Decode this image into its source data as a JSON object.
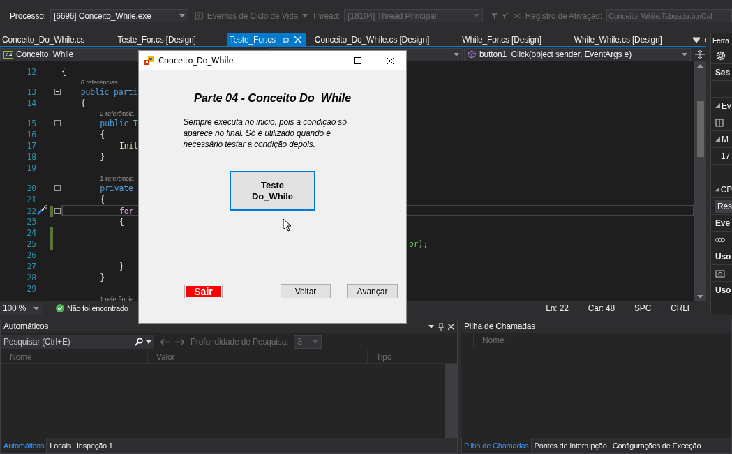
{
  "toolbar": {
    "process_label": "Processo:",
    "process": "[6696] Conceito_While.exe",
    "lifecycle": "Eventos de Ciclo de Vida",
    "thread_label": "Thread:",
    "thread": "[18104] Thread Principal",
    "frame_label": "Registro de Ativação:",
    "frame": "Conceito_While.Tabuada.btnCal"
  },
  "tabs": [
    {
      "label": "Conceito_Do_While.cs",
      "selected": false
    },
    {
      "label": "Teste_For.cs [Design]",
      "selected": false
    },
    {
      "label": "Teste_For.cs",
      "selected": true
    },
    {
      "label": "Conceito_Do_While.cs [Design]",
      "selected": false
    },
    {
      "label": "While_For.cs [Design]",
      "selected": false
    },
    {
      "label": "While_While.cs [Design]",
      "selected": false
    }
  ],
  "nav_bar": {
    "project": "Conceito_While",
    "member": "button1_Click(object sender, EventArgs e)"
  },
  "code_lines": [
    {
      "number": "12",
      "segments": [
        {
          "text": "{",
          "kind": "plain"
        }
      ],
      "collapsible": false,
      "changed": false,
      "current": false,
      "children": [
        {
          "number": "13",
          "lens": "6 referências",
          "segments": [
            {
              "text": "public parti",
              "kind": "keyword"
            }
          ],
          "collapsible": true,
          "changed": false,
          "current": false
        },
        {
          "number": "14",
          "segments": [
            {
              "text": "{",
              "kind": "plain"
            }
          ],
          "collapsible": false,
          "changed": false,
          "current": false,
          "children": [
            {
              "number": "15",
              "lens": "2 referência",
              "segments": [
                {
                  "text": "public ",
                  "kind": "keyword"
                },
                {
                  "text": "T",
                  "kind": "type"
                }
              ],
              "collapsible": true,
              "changed": false,
              "current": false
            },
            {
              "number": "16",
              "segments": [
                {
                  "text": "{",
                  "kind": "plain"
                }
              ],
              "collapsible": false,
              "changed": false,
              "current": false,
              "children": [
                {
                  "number": "17",
                  "segments": [
                    {
                      "text": "Init",
                      "kind": "method"
                    }
                  ],
                  "collapsible": false,
                  "changed": false,
                  "current": false
                }
              ]
            },
            {
              "number": "18",
              "segments": [
                {
                  "text": "}",
                  "kind": "plain"
                }
              ],
              "collapsible": false,
              "changed": false,
              "current": false
            },
            {
              "number": "19",
              "collapsible": false,
              "changed": false,
              "current": false
            },
            {
              "number": "20",
              "lens": "1 referência",
              "segments": [
                {
                  "text": "private",
                  "kind": "keyword"
                }
              ],
              "collapsible": true,
              "changed": false,
              "current": false
            },
            {
              "number": "21",
              "segments": [
                {
                  "text": "{",
                  "kind": "plain"
                }
              ],
              "collapsible": false,
              "changed": false,
              "current": false,
              "children": [
                {
                  "number": "22",
                  "segments": [
                    {
                      "text": "for",
                      "kind": "control"
                    }
                  ],
                  "collapsible": true,
                  "changed": true,
                  "current": true
                },
                {
                  "number": "23",
                  "segments": [
                    {
                      "text": "{",
                      "kind": "plain"
                    }
                  ],
                  "collapsible": false,
                  "changed": false,
                  "current": false,
                  "children": [
                    {
                      "number": "24",
                      "collapsible": false,
                      "changed": true,
                      "current": false
                    },
                    {
                      "number": "25",
                      "tail": "or);",
                      "collapsible": false,
                      "changed": true,
                      "current": false
                    },
                    {
                      "number": "26",
                      "collapsible": false,
                      "changed": false,
                      "current": false
                    }
                  ]
                },
                {
                  "number": "27",
                  "segments": [
                    {
                      "text": "}",
                      "kind": "plain"
                    }
                  ],
                  "collapsible": false,
                  "changed": false,
                  "current": false
                }
              ]
            },
            {
              "number": "28",
              "segments": [
                {
                  "text": "}",
                  "kind": "plain"
                }
              ],
              "collapsible": false,
              "changed": false,
              "current": false
            },
            {
              "number": "29",
              "collapsible": false,
              "changed": false,
              "current": false
            }
          ]
        }
      ]
    }
  ],
  "code_footer_lens": "1 referência",
  "editor_status": {
    "zoom": "100 %",
    "issues": "Não foi encontrado",
    "line": "Ln: 22",
    "column": "Car: 48",
    "whitespace": "SPC",
    "line_ending": "CRLF"
  },
  "side_panel": {
    "title": "Ferra",
    "items": [
      {
        "kind": "gear"
      },
      {
        "kind": "heading",
        "text": "Ses"
      },
      {
        "kind": "blank"
      },
      {
        "kind": "group",
        "text": "Ev"
      },
      {
        "kind": "columns"
      },
      {
        "kind": "group",
        "text": "M"
      },
      {
        "kind": "value",
        "text": "17"
      },
      {
        "kind": "blank"
      },
      {
        "kind": "group",
        "text": "CP"
      },
      {
        "kind": "tab",
        "text": "Res"
      },
      {
        "kind": "heading",
        "text": "Eve"
      },
      {
        "kind": "dots"
      },
      {
        "kind": "heading",
        "text": "Uso"
      },
      {
        "kind": "camera"
      },
      {
        "kind": "heading",
        "text": "Uso"
      }
    ]
  },
  "dialog": {
    "title": "Conceito_Do_While",
    "heading": "Parte 04 - Conceito Do_While",
    "description": "Sempre executa no inicio, pois a condição só aparece no final. Só é utilizado quando é necessário testar a condição depois.",
    "main_button": "Teste Do_While",
    "exit_button": "Sair",
    "back_button": "Voltar",
    "next_button": "Avançar"
  },
  "autos_panel": {
    "title": "Automáticos",
    "search_placeholder": "Pesquisar (Ctrl+E)",
    "depth_label": "Profundidade de Pesquisa:",
    "depth": "3",
    "columns": [
      "Nome",
      "Valor",
      "Tipo"
    ],
    "tabs": [
      {
        "label": "Automáticos",
        "selected": true
      },
      {
        "label": "Locais",
        "selected": false
      },
      {
        "label": "Inspeção 1",
        "selected": false
      }
    ]
  },
  "call_stack_panel": {
    "title": "Pilha de Chamadas",
    "columns": [
      "Nome"
    ],
    "tabs": [
      {
        "label": "Pilha de Chamadas",
        "selected": true
      },
      {
        "label": "Pontos de Interrupção",
        "selected": false
      },
      {
        "label": "Configurações de Exceção",
        "selected": false
      }
    ]
  }
}
